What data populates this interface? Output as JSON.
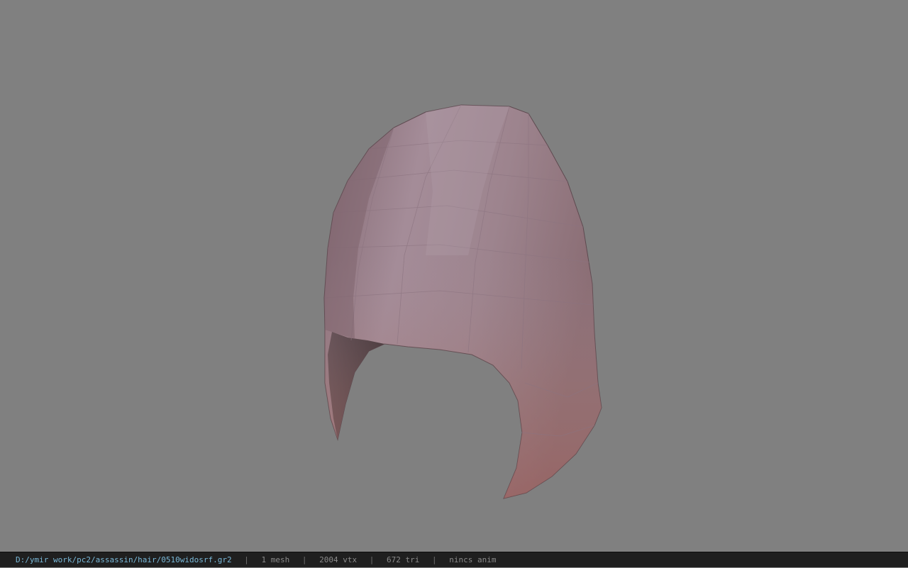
{
  "viewport": {
    "background_color": "#808080",
    "model": {
      "name": "hair-hood-mesh",
      "colors": {
        "base": "#9b8088",
        "light": "#a9929c",
        "shadow": "#7e6168",
        "rust": "#a26a66",
        "inner": "#3e3438"
      }
    }
  },
  "status_bar": {
    "file_path": "D:/ymir work/pc2/assassin/hair/0510widosrf.gr2",
    "separator": "|",
    "mesh_count": "1 mesh",
    "vertex_count": "2004 vtx",
    "triangle_count": "672 tri",
    "anim_info": "nincs anim"
  }
}
